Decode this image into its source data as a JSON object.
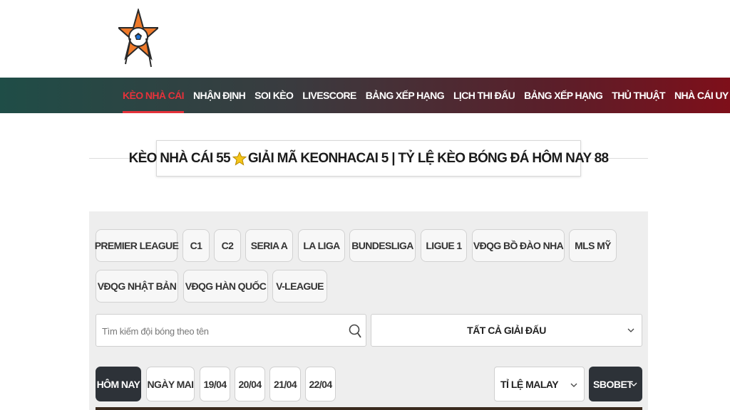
{
  "nav": {
    "items": [
      {
        "label": "KÈO NHÀ CÁI",
        "active": true
      },
      {
        "label": "NHẬN ĐỊNH"
      },
      {
        "label": "SOI KÈO"
      },
      {
        "label": "LIVESCORE"
      },
      {
        "label": "BẢNG XẾP HẠNG"
      },
      {
        "label": "LỊCH THI ĐẤU"
      },
      {
        "label": "BẢNG XẾP HẠNG"
      },
      {
        "label": "THỦ THUẬT"
      },
      {
        "label": "NHÀ CÁI UY TÍN"
      }
    ]
  },
  "title": {
    "before_star": "KÈO NHÀ CÁI 55",
    "after_star": "GIẢI MÃ KEONHACAI 5 | TỶ LỆ KÈO BÓNG ĐÁ HÔM NAY 88",
    "star_icon": "star-icon"
  },
  "leagues": [
    "PREMIER LEAGUE",
    "C1",
    "C2",
    "SERIA A",
    "LA LIGA",
    "BUNDESLIGA",
    "LIGUE 1",
    "VĐQG BỒ ĐÀO NHA",
    "MLS MỸ",
    "VĐQG NHẬT BẢN",
    "VĐQG HÀN QUỐC",
    "V-LEAGUE"
  ],
  "search": {
    "placeholder": "Tìm kiếm đội bóng theo tên",
    "icon": "search-icon"
  },
  "league_filter": {
    "selected": "TẤT CẢ GIẢI ĐẤU"
  },
  "days": [
    {
      "label": "HÔM NAY",
      "active": true
    },
    {
      "label": "NGÀY MAI"
    },
    {
      "label": "19/04"
    },
    {
      "label": "20/04"
    },
    {
      "label": "21/04"
    },
    {
      "label": "22/04"
    }
  ],
  "odds_type": {
    "selected": "TỈ LỆ MALAY"
  },
  "bookmaker": {
    "selected": "SBOBET"
  },
  "colors": {
    "accent_red": "#e5323b",
    "dark_button": "#2d3238",
    "nav_gradient_start": "#1f4d47",
    "nav_gradient_end": "#7e0f1a"
  }
}
